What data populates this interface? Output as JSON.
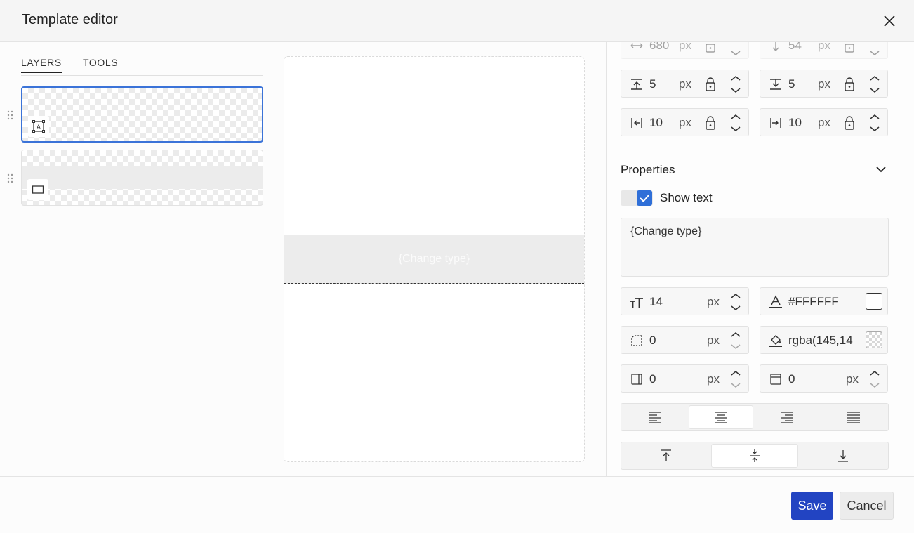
{
  "header": {
    "title": "Template editor"
  },
  "tabs": [
    {
      "label": "LAYERS",
      "active": true
    },
    {
      "label": "TOOLS",
      "active": false
    }
  ],
  "layers": [
    {
      "type": "text",
      "icon": "text-frame-icon",
      "selected": true
    },
    {
      "type": "rectangle",
      "icon": "rectangle-icon",
      "selected": false
    }
  ],
  "canvas": {
    "band_text": "{Change type}"
  },
  "dimensions": {
    "width": {
      "value": "680",
      "unit": "px",
      "icon": "width-arrows-icon"
    },
    "height": {
      "value": "54",
      "unit": "px",
      "icon": "height-arrow-icon"
    },
    "margin_top": {
      "value": "5",
      "unit": "px",
      "icon": "margin-top-icon"
    },
    "margin_bottom": {
      "value": "5",
      "unit": "px",
      "icon": "margin-bottom-icon"
    },
    "margin_left": {
      "value": "10",
      "unit": "px",
      "icon": "margin-left-icon"
    },
    "margin_right": {
      "value": "10",
      "unit": "px",
      "icon": "margin-right-icon"
    }
  },
  "properties": {
    "title": "Properties",
    "show_text_label": "Show text",
    "show_text_checked": true,
    "text_value": "{Change type}",
    "font_size": {
      "value": "14",
      "unit": "px",
      "icon": "font-size-icon"
    },
    "text_color": {
      "value": "#FFFFFF",
      "icon": "text-color-icon"
    },
    "border_radius": {
      "value": "0",
      "unit": "px",
      "icon": "border-radius-icon"
    },
    "fill_color": {
      "value": "rgba(145,14",
      "icon": "fill-color-icon"
    },
    "padding_left": {
      "value": "0",
      "unit": "px",
      "icon": "padding-left-icon"
    },
    "padding_top": {
      "value": "0",
      "unit": "px",
      "icon": "padding-top-icon"
    },
    "text_align_options": [
      "align-left-icon",
      "align-center-icon",
      "align-right-icon",
      "align-justify-icon"
    ],
    "text_align_selected": "align-center-icon",
    "vertical_align_options": [
      "align-top-icon",
      "align-middle-icon",
      "align-bottom-icon"
    ],
    "vertical_align_selected": "align-middle-icon"
  },
  "footer": {
    "save_label": "Save",
    "cancel_label": "Cancel"
  },
  "colors": {
    "primary": "#2244c2",
    "checkbox": "#2f6fd8",
    "selection_border": "#3b73d8"
  }
}
